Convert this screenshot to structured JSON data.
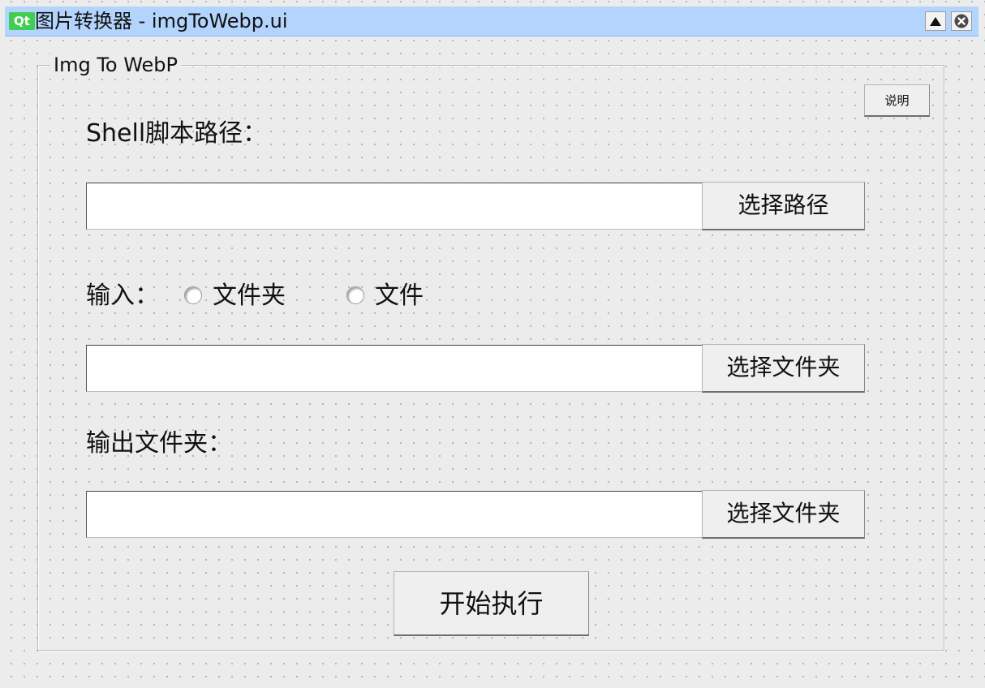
{
  "window": {
    "title": "图片转换器 - imgToWebp.ui",
    "logo_text": "Qt"
  },
  "group": {
    "title": "Img To WebP",
    "help_button": "说明"
  },
  "shell": {
    "label": "Shell脚本路径：",
    "input_value": "",
    "button": "选择路径"
  },
  "input": {
    "label": "输入：",
    "radio_folder": "文件夹",
    "radio_file": "文件",
    "field_value": "",
    "button": "选择文件夹"
  },
  "output": {
    "label": "输出文件夹：",
    "field_value": "",
    "button": "选择文件夹"
  },
  "run_button": "开始执行",
  "colors": {
    "titlebar": "#b3d4fd",
    "background": "#ececec",
    "qt_green": "#41cd52"
  },
  "icons": {
    "maximize": "triangle-up-icon",
    "close": "close-circle-icon"
  }
}
